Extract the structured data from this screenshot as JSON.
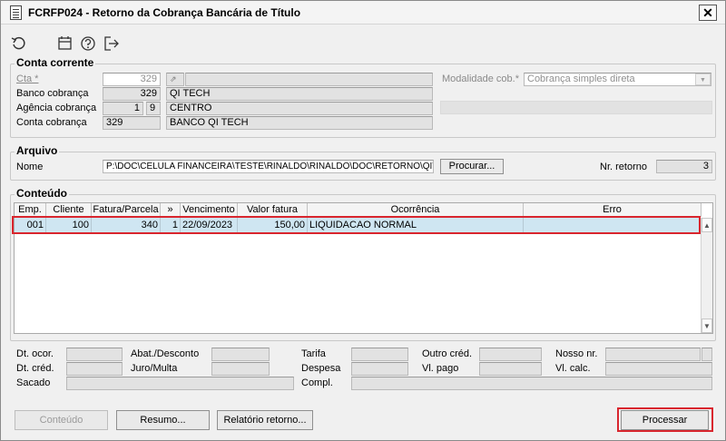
{
  "window": {
    "title": "FCRFP024 - Retorno da Cobrança Bancária de Título",
    "close": "✕"
  },
  "toolbar": {
    "icons": [
      "refresh-icon",
      "calendar-icon",
      "help-icon",
      "exit-icon"
    ]
  },
  "conta_corrente": {
    "title": "Conta corrente",
    "cta_label": "Cta *",
    "cta_value": "329",
    "banco_label": "Banco cobrança",
    "banco_code": "329",
    "banco_name": "QI TECH",
    "agencia_label": "Agência cobrança",
    "agencia_code": "1",
    "agencia_dv": "9",
    "agencia_name": "CENTRO",
    "conta_label": "Conta cobrança",
    "conta_value": "329",
    "conta_name": "BANCO QI TECH",
    "modalidade_label": "Modalidade cob.*",
    "modalidade_value": "Cobrança simples direta"
  },
  "arquivo": {
    "title": "Arquivo",
    "nome_label": "Nome",
    "nome_value": "P:\\DOC\\CELULA FINANCEIRA\\TESTE\\RINALDO\\RINALDO\\DOC\\RETORNO\\QIT",
    "procurar": "Procurar...",
    "nr_label": "Nr. retorno",
    "nr_value": "3"
  },
  "conteudo": {
    "title": "Conteúdo",
    "columns": [
      "Emp.",
      "Cliente",
      "Fatura/Parcela",
      "»",
      "Vencimento",
      "Valor fatura",
      "Ocorrência",
      "Erro"
    ],
    "rows": [
      {
        "emp": "001",
        "cliente": "100",
        "fatura": "340",
        "parcela": "1",
        "vencimento": "22/09/2023",
        "valor": "150,00",
        "ocorrencia": "LIQUIDACAO NORMAL",
        "erro": ""
      }
    ]
  },
  "details": {
    "dt_ocor": "Dt. ocor.",
    "abat": "Abat./Desconto",
    "tarifa": "Tarifa",
    "outro_cred": "Outro créd.",
    "nosso_nr": "Nosso nr.",
    "dt_cred": "Dt. créd.",
    "juro": "Juro/Multa",
    "despesa": "Despesa",
    "vl_pago": "Vl. pago",
    "vl_calc": "Vl. calc.",
    "sacado": "Sacado",
    "compl": "Compl."
  },
  "buttons": {
    "conteudo": "Conteúdo",
    "resumo": "Resumo...",
    "relatorio": "Relatório retorno...",
    "processar": "Processar"
  },
  "colors": {
    "highlight": "#d9262e",
    "row_selected": "#cfe6f2"
  }
}
